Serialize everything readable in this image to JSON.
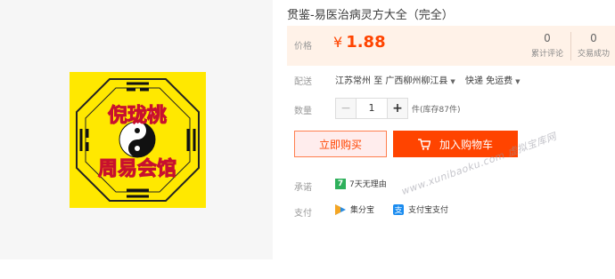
{
  "product": {
    "title": "贯鉴-易医治病灵方大全（完全）",
    "image_texts": {
      "top": "倪珑桃",
      "bottom": "周易会馆"
    }
  },
  "price": {
    "label": "价格",
    "currency": "¥",
    "amount": "1.88",
    "review_count": "0",
    "review_label": "累计评论",
    "sales_count": "0",
    "sales_label": "交易成功"
  },
  "shipping": {
    "label": "配送",
    "from": "江苏常州",
    "to_word": "至",
    "to": "广西柳州柳江县",
    "method": "快递 免运费"
  },
  "quantity": {
    "label": "数量",
    "minus": "−",
    "value": "1",
    "plus": "+",
    "stock": "件(库存87件)"
  },
  "actions": {
    "buy_now": "立即购买",
    "add_to_cart": "加入购物车"
  },
  "promise": {
    "label": "承诺",
    "icon_text": "7",
    "text": "7天无理由"
  },
  "payment": {
    "label": "支付",
    "method1": "集分宝",
    "method2": "支付宝支付"
  },
  "watermark": "www.xunibaoku.com 虚拟宝库网",
  "colors": {
    "accent": "#ff4400",
    "price_bg": "#fff2e8",
    "image_yellow": "#ffe800"
  }
}
